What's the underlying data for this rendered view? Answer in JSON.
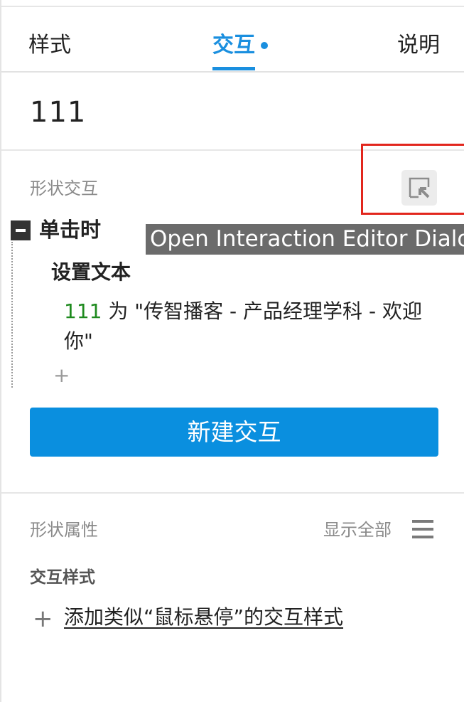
{
  "tabs": [
    {
      "label": "样式"
    },
    {
      "label": "交互"
    },
    {
      "label": "说明"
    }
  ],
  "widget": {
    "name": "111"
  },
  "shape_interactions": {
    "label": "形状交互",
    "tooltip": "Open Interaction Editor Dialog",
    "event": {
      "name": "单击时"
    },
    "action": {
      "name": "设置文本",
      "target": "111",
      "detail": " 为 \"传智播客 - 产品经理学科 - 欢迎你\""
    },
    "add_action": "+",
    "new_button": "新建交互"
  },
  "shape_properties": {
    "label": "形状属性",
    "show_all": "显示全部",
    "sub_label": "交互样式",
    "add_plus": "+",
    "add_style_link": "添加类似“鼠标悬停”的交互样式"
  },
  "colors": {
    "accent": "#1a8fdf",
    "button": "#0a8fdf",
    "highlight": "#e2261d",
    "target_text": "#1e8a1e",
    "tooltip_bg": "#6b6b6b"
  }
}
